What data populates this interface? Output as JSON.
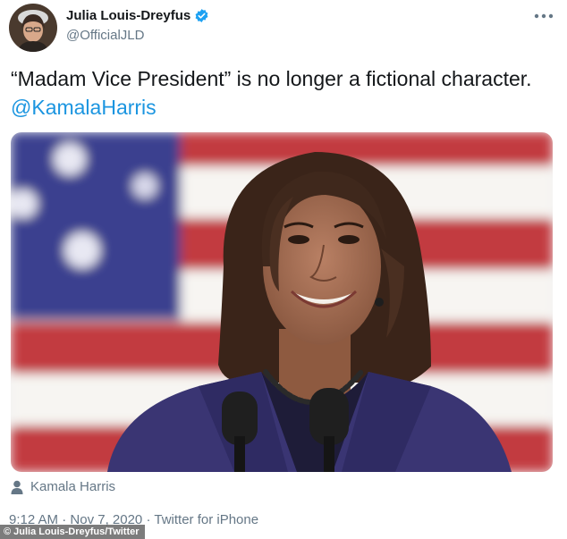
{
  "tweet": {
    "author": {
      "display_name": "Julia Louis-Dreyfus",
      "handle": "@OfficialJLD",
      "verified": true
    },
    "more_icon": "more-horizontal-icon",
    "text_before": "“Madam Vice President” is no longer a fictional character.",
    "mention": "@KamalaHarris",
    "tagged_user": "Kamala Harris",
    "tagged_icon": "person-icon",
    "meta": {
      "time": "9:12 AM",
      "separator": "·",
      "date": "Nov 7, 2020",
      "source": "Twitter for iPhone"
    }
  },
  "photo_credit": "© Julia Louis-Dreyfus/Twitter",
  "colors": {
    "link": "#1b95e0",
    "secondary_text": "#657786",
    "verified_badge": "#1da1f2"
  }
}
